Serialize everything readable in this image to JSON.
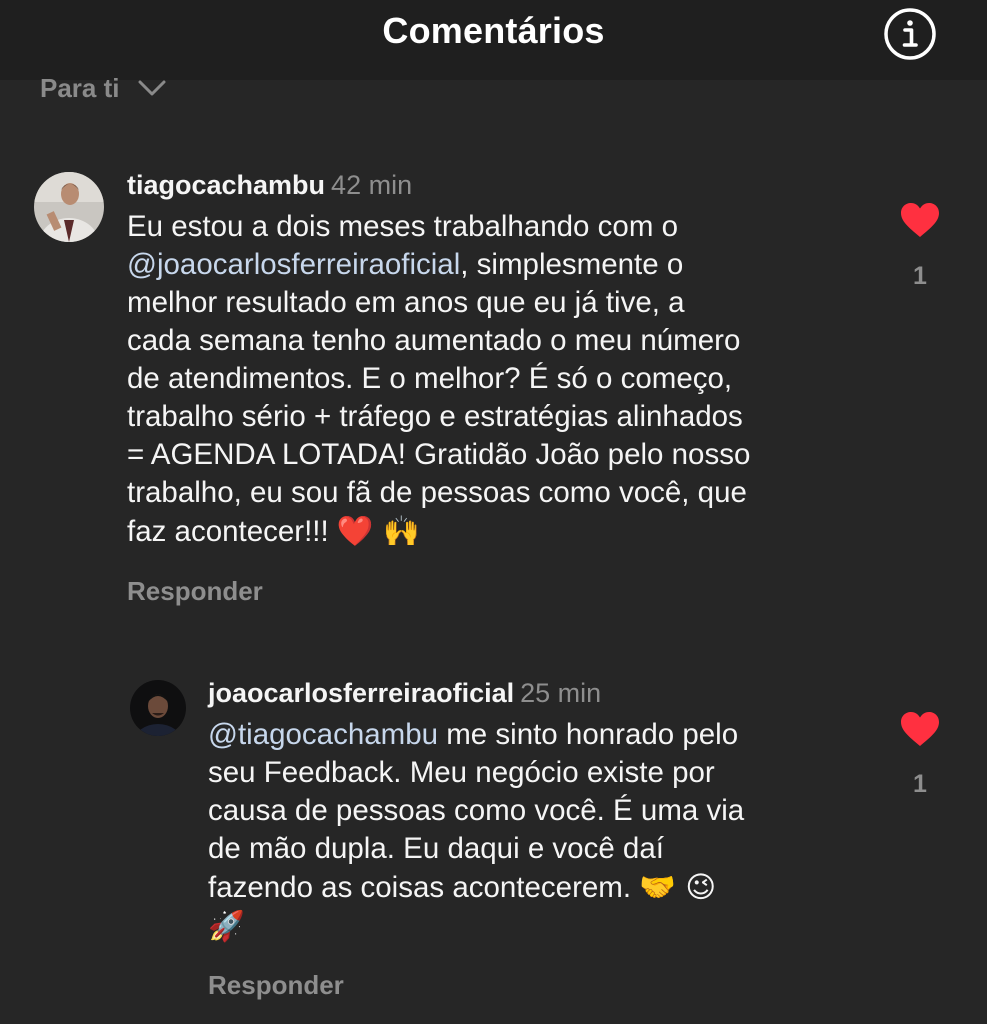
{
  "header": {
    "title": "Comentários",
    "info_icon": "info-circle-icon"
  },
  "filter": {
    "label": "Para ti",
    "icon": "chevron-down-icon"
  },
  "comments": [
    {
      "username": "tiagocachambu",
      "time": "42 min",
      "body_lines": [
        "Eu estou a dois meses trabalhando com o",
        ", simplesmente o",
        "melhor resultado em anos que eu já tive, a",
        "cada semana tenho aumentado o meu número",
        "de atendimentos. E o melhor? É só o começo,",
        "trabalho sério + tráfego e estratégias alinhados",
        "= AGENDA LOTADA! Gratidão João pelo nosso",
        "trabalho, eu sou fã de pessoas como você, que",
        "faz acontecer!!! "
      ],
      "mention": "@joaocarlosferreiraoficial",
      "emojis": "❤️ 🙌",
      "reply_label": "Responder",
      "likes": "1",
      "liked": true
    },
    {
      "username": "joaocarlosferreiraoficial",
      "time": "25 min",
      "mention": "@tiagocachambu",
      "body_lines": [
        " me sinto honrado pelo",
        "seu Feedback. Meu negócio existe por",
        "causa de pessoas como você. É uma via",
        "de mão dupla. Eu daqui e você daí",
        "fazendo as coisas acontecerem. "
      ],
      "emojis": "🤝 😉",
      "emojis_2": "🚀",
      "reply_label": "Responder",
      "likes": "1",
      "liked": true
    }
  ],
  "colors": {
    "background": "#262626",
    "header": "#1f1f1f",
    "like": "#ff3040",
    "mention": "#c7d7ec",
    "muted": "#8e8e8e"
  }
}
